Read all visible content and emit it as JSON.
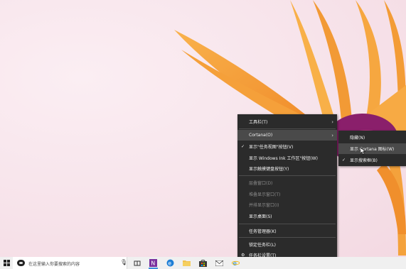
{
  "colors": {
    "menu_bg": "#2b2b2b",
    "menu_text": "#f2f2f2",
    "menu_disabled": "#8a8a8a",
    "highlight": "#4a4a4a",
    "taskbar_bg": "#f0f0f0",
    "petal": "#f6a23c",
    "flower_center": "#8a1f6b"
  },
  "context_menu": {
    "items": [
      {
        "label": "工具栏(T)",
        "submenu": true
      },
      {
        "label": "Cortana(O)",
        "submenu": true,
        "highlighted": true
      },
      {
        "label": "显示\"任务视图\"按钮(V)",
        "checked": true
      },
      {
        "label": "显示 Windows Ink 工作区\"按钮(W)"
      },
      {
        "label": "显示触摸键盘按钮(Y)"
      },
      {
        "label": "层叠窗口(D)",
        "disabled": true
      },
      {
        "label": "堆叠显示窗口(T)",
        "disabled": true
      },
      {
        "label": "并排显示窗口(I)",
        "disabled": true
      },
      {
        "label": "显示桌面(S)"
      },
      {
        "label": "任务管理器(K)"
      },
      {
        "label": "锁定任务栏(L)"
      },
      {
        "label": "任务栏设置(T)",
        "icon": "gear-icon"
      }
    ]
  },
  "cortana_submenu": {
    "items": [
      {
        "label": "隐藏(N)"
      },
      {
        "label": "显示 Cortana 图标(W)",
        "highlighted": true
      },
      {
        "label": "显示搜索框(B)",
        "checked": true
      }
    ]
  },
  "taskbar": {
    "search_placeholder": "在这里输入你要搜索的内容",
    "icons": [
      "start-icon",
      "cortana-icon",
      "microphone-icon",
      "task-view-icon",
      "onenote-icon",
      "edge-icon",
      "file-explorer-icon",
      "store-icon",
      "mail-icon",
      "ie-icon"
    ]
  }
}
